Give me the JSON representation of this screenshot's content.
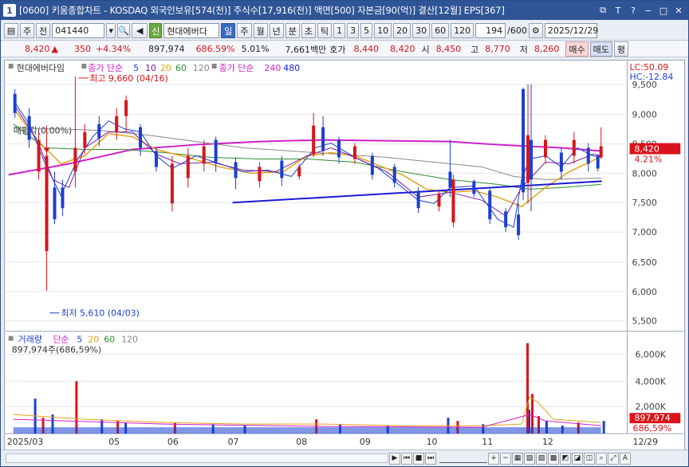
{
  "title": {
    "number": "1",
    "text": "[0600] 키움종합차트 - KOSDAQ 외국인보유[574(천)] 주식수[17,916(천)] 액면[500] 자본금[90(억)] 결산[12월] EPS[367]"
  },
  "toolbar": {
    "period_label": "주",
    "prev_label": "전",
    "code": "041440",
    "stock_name": "현대에버다",
    "stock_badge": "신",
    "intervals": [
      "일",
      "주",
      "월",
      "년",
      "분",
      "초",
      "틱"
    ],
    "selected_interval": "일",
    "minute_options": [
      "1",
      "3",
      "5",
      "10",
      "20",
      "30",
      "60",
      "120"
    ],
    "count": "194",
    "total": "/600",
    "date": "2025/12/29"
  },
  "infobar": {
    "price": "8,420",
    "change": "350",
    "change_pct": "+4.34%",
    "volume": "897,974",
    "volume_ratio": "686.59%",
    "turnover": "5.01%",
    "amount": "7,661백만",
    "quote_label": "호가",
    "ask": "8,440",
    "bid": "8,420",
    "open_label": "시",
    "open": "8,450",
    "high_label": "고",
    "high": "8,770",
    "low_label": "저",
    "low": "8,260",
    "buy_label": "매수",
    "sell_label": "매도",
    "eval_label": "평"
  },
  "price_panel": {
    "stock_label": "현대에버다임",
    "ma_label": "종가 단순",
    "ma_periods": [
      "5",
      "10",
      "20",
      "60",
      "120"
    ],
    "ma_long_label": "종가 단순",
    "ma_long": [
      "240",
      "480"
    ],
    "lc": "LC:50.09",
    "hc": "HC:-12.84",
    "high_marker": "최고 9,660 (04/16)",
    "low_marker": "최저 5,610 (04/03)",
    "pretrend": "매평칵(0.00%)",
    "current_price_tag": "8,420",
    "current_pct_tag": "4.21%",
    "y_ticks": [
      "9,500",
      "9,000",
      "8,500",
      "8,000",
      "7,500",
      "7,000",
      "6,500",
      "6,000",
      "5,500"
    ]
  },
  "volume_panel": {
    "label": "거래량",
    "ma_label": "단순",
    "ma_periods": [
      "5",
      "20",
      "60",
      "120"
    ],
    "current": "897,974주(686,59%)",
    "tag_volume": "897,974",
    "tag_pct": "686,59%",
    "y_ticks": [
      "6,000K",
      "4,000K",
      "2,000K"
    ]
  },
  "x_axis": [
    "2025/03",
    "05",
    "06",
    "07",
    "08",
    "09",
    "10",
    "11",
    "12",
    "12/29"
  ],
  "colors": {
    "up": "#d8141a",
    "down": "#1a3fd0",
    "ma5": "#1a3fd0",
    "ma10": "#7a1aa8",
    "ma20": "#e5a21a",
    "ma60": "#2e8b2e",
    "ma120": "#888888",
    "ma240": "#d020c8",
    "trend": "#1a1ad8"
  }
}
